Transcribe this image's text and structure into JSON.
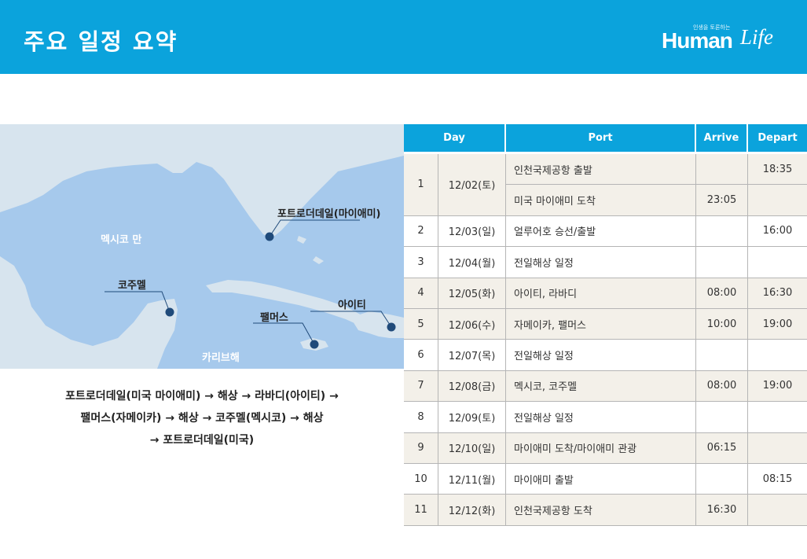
{
  "header": {
    "title": "주요 일정 요약",
    "brand_color": "#0ba3dc",
    "logo": {
      "tagline": "인생을 토론하는",
      "main": "Human",
      "script": "Life"
    }
  },
  "map": {
    "colors": {
      "water": "#a6c9ec",
      "land": "#d7e4ee",
      "marker": "#1f4a7a"
    },
    "labels": {
      "gulf": "멕시코 만",
      "caribbean": "카리브해",
      "fort_lauderdale": "포트로더데일(마이애미)",
      "cozumel": "코주멜",
      "palmas": "팰머스",
      "haiti": "아이티"
    }
  },
  "route": {
    "lines": [
      "포트로더데일(미국 마이애미) → 해상 → 라바디(아이티) →",
      "팰머스(자메이카) → 해상 → 코주멜(멕시코) → 해상",
      "→ 포트로더데일(미국)"
    ]
  },
  "schedule": {
    "headers": {
      "day": "Day",
      "port": "Port",
      "arrive": "Arrive",
      "depart": "Depart"
    },
    "row_colors": {
      "shaded": "#f3f0e9",
      "plain": "#ffffff"
    },
    "rows": [
      {
        "no": "1",
        "date": "12/02(토)",
        "port": "인천국제공항 출발",
        "arrive": "",
        "depart": "18:35"
      },
      {
        "no": "",
        "date": "",
        "port": "미국 마이애미 도착",
        "arrive": "23:05",
        "depart": ""
      },
      {
        "no": "2",
        "date": "12/03(일)",
        "port": "얼루어호 승선/출발",
        "arrive": "",
        "depart": "16:00"
      },
      {
        "no": "3",
        "date": "12/04(월)",
        "port": "전일해상 일정",
        "arrive": "",
        "depart": ""
      },
      {
        "no": "4",
        "date": "12/05(화)",
        "port": "아이티, 라바디",
        "arrive": "08:00",
        "depart": "16:30"
      },
      {
        "no": "5",
        "date": "12/06(수)",
        "port": "자메이카, 팰머스",
        "arrive": "10:00",
        "depart": "19:00"
      },
      {
        "no": "6",
        "date": "12/07(목)",
        "port": "전일해상 일정",
        "arrive": "",
        "depart": ""
      },
      {
        "no": "7",
        "date": "12/08(금)",
        "port": "멕시코, 코주멜",
        "arrive": "08:00",
        "depart": "19:00"
      },
      {
        "no": "8",
        "date": "12/09(토)",
        "port": "전일해상 일정",
        "arrive": "",
        "depart": ""
      },
      {
        "no": "9",
        "date": "12/10(일)",
        "port": "마이애미 도착/마이애미 관광",
        "arrive": "06:15",
        "depart": ""
      },
      {
        "no": "10",
        "date": "12/11(월)",
        "port": "마이애미 출발",
        "arrive": "",
        "depart": "08:15"
      },
      {
        "no": "11",
        "date": "12/12(화)",
        "port": "인천국제공항 도착",
        "arrive": "16:30",
        "depart": ""
      }
    ]
  }
}
